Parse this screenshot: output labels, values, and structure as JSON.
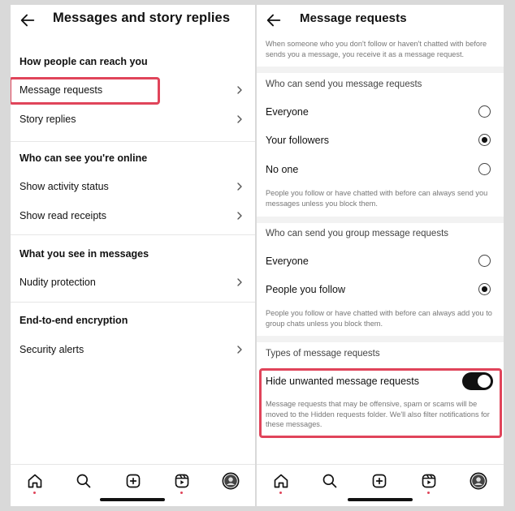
{
  "left": {
    "title": "Messages and story replies",
    "sections": {
      "reach": {
        "title": "How people can reach you",
        "message_requests": "Message requests",
        "story_replies": "Story replies"
      },
      "online": {
        "title": "Who can see you're online",
        "activity_status": "Show activity status",
        "read_receipts": "Show read receipts"
      },
      "see": {
        "title": "What you see in messages",
        "nudity": "Nudity protection"
      },
      "e2e": {
        "title": "End-to-end encryption",
        "security_alerts": "Security alerts"
      }
    }
  },
  "right": {
    "title": "Message requests",
    "intro": "When someone who you don't follow or haven't chatted with before sends you a message, you receive it as a message request.",
    "who_send": {
      "title": "Who can send you message requests",
      "options": [
        "Everyone",
        "Your followers",
        "No one"
      ],
      "selected": "Your followers",
      "note": "People you follow or have chatted with before can always send you messages unless you block them."
    },
    "who_group": {
      "title": "Who can send you group message requests",
      "options": [
        "Everyone",
        "People you follow"
      ],
      "selected": "People you follow",
      "note": "People you follow or have chatted with before can always add you to group chats unless you block them."
    },
    "types": {
      "title": "Types of message requests",
      "hide_label": "Hide unwanted message requests",
      "hide_enabled": true,
      "hide_note": "Message requests that may be offensive, spam or scams will be moved to the Hidden requests folder. We'll also filter notifications for these messages."
    }
  },
  "nav_icons": [
    "home-icon",
    "search-icon",
    "create-icon",
    "reels-icon",
    "profile-icon"
  ],
  "colors": {
    "highlight": "#e0445a",
    "toggle_on": "#111111"
  }
}
